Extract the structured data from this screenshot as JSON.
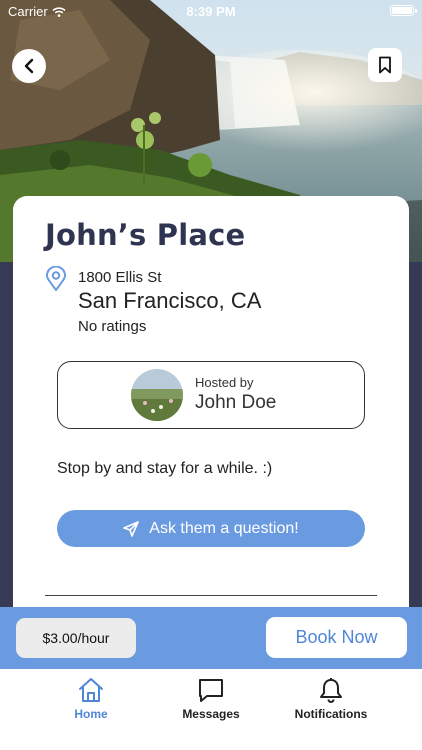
{
  "status_bar": {
    "carrier": "Carrier",
    "time": "8:39 PM"
  },
  "header": {
    "back_icon": "chevron-left-icon",
    "bookmark_icon": "bookmark-icon"
  },
  "listing": {
    "title": "John’s Place",
    "street": "1800 Ellis St",
    "city": "San Francisco, CA",
    "ratings": "No ratings",
    "location_icon": "map-pin-icon"
  },
  "host": {
    "label": "Hosted by",
    "name": "John Doe"
  },
  "description": "Stop by and stay for a while. :)",
  "ask_button": {
    "label": "Ask them a question!",
    "icon": "send-icon"
  },
  "booking": {
    "price": "$3.00/hour",
    "book_label": "Book Now"
  },
  "tabs": [
    {
      "label": "Home",
      "icon": "home-icon",
      "active": true
    },
    {
      "label": "Messages",
      "icon": "message-icon",
      "active": false
    },
    {
      "label": "Notifications",
      "icon": "bell-icon",
      "active": false
    }
  ],
  "colors": {
    "accent": "#6a9be0",
    "title": "#2f3550",
    "background": "#363a54"
  }
}
